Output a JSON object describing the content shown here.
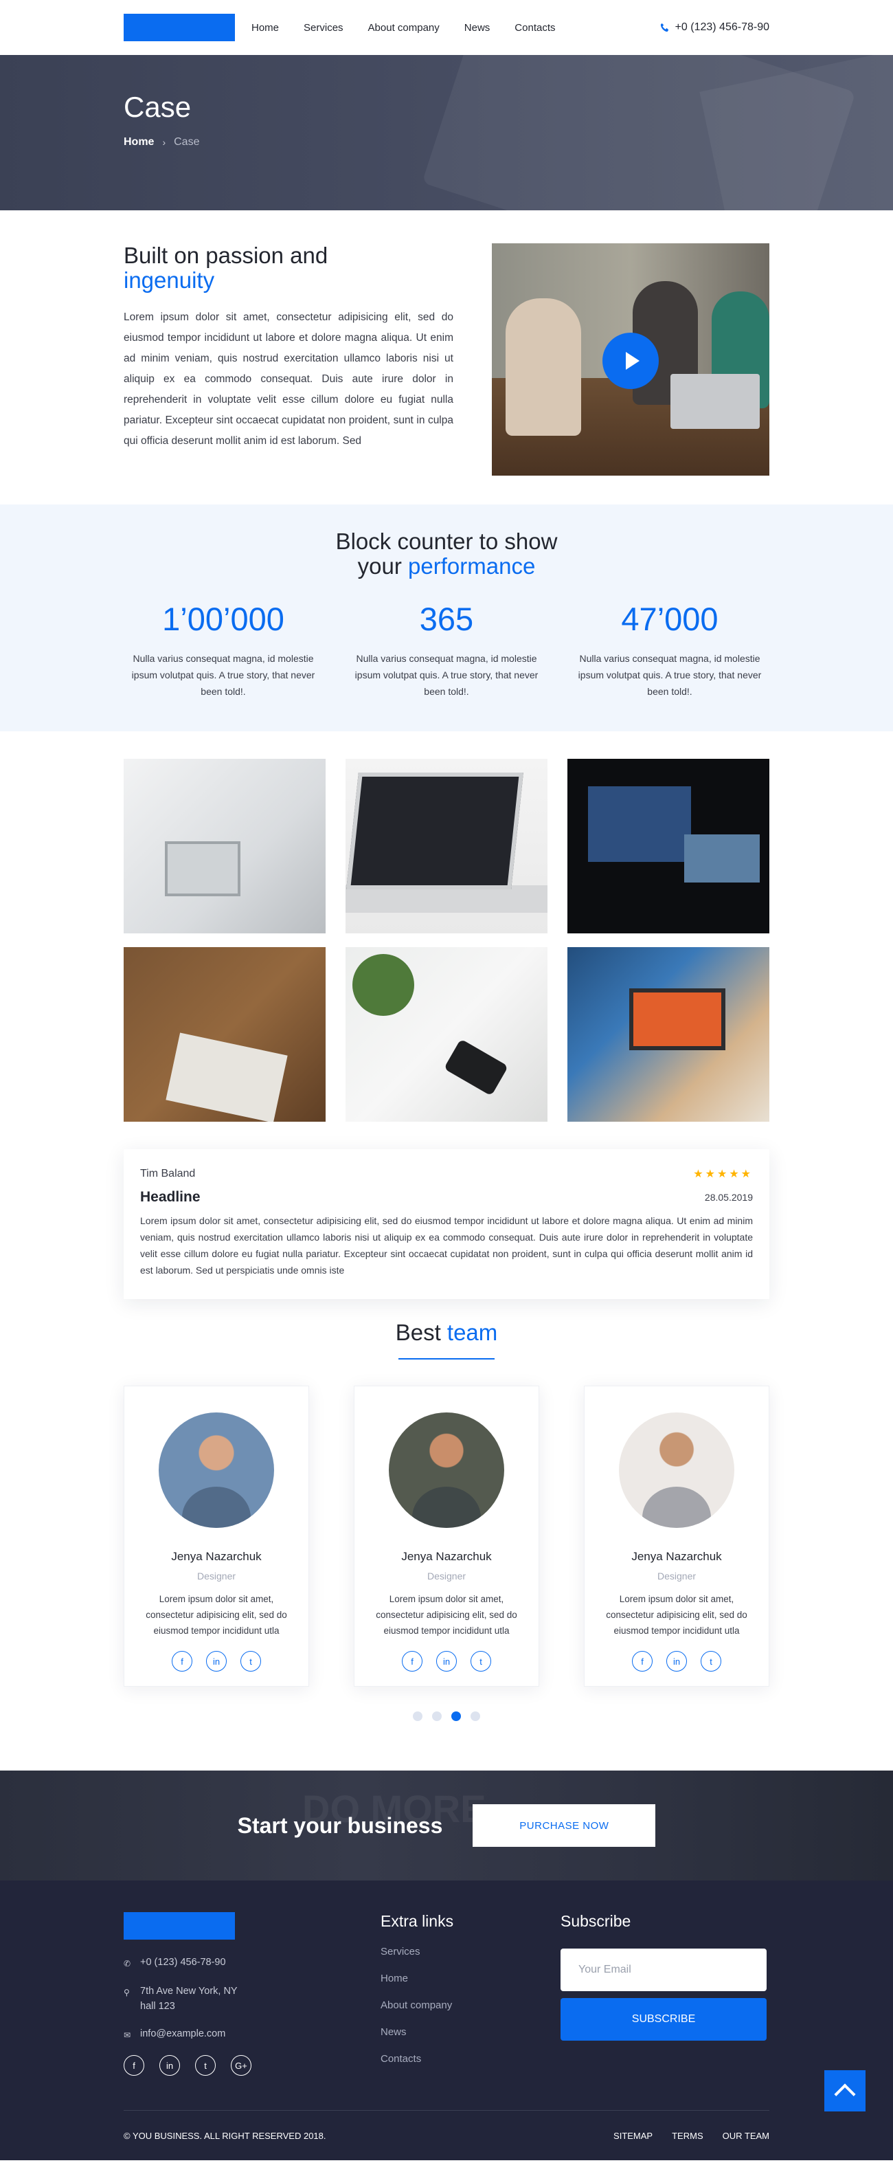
{
  "header": {
    "nav": [
      "Home",
      "Services",
      "About company",
      "News",
      "Contacts"
    ],
    "phone": "+0 (123) 456-78-90"
  },
  "hero": {
    "title": "Case",
    "breadcrumb": {
      "home": "Home",
      "separator": "›",
      "current": "Case"
    }
  },
  "intro": {
    "title_line1": "Built on passion and",
    "title_accent": "ingenuity",
    "text": "Lorem ipsum dolor sit amet, consectetur adipisicing elit, sed do eiusmod tempor incididunt ut labore et dolore magna aliqua. Ut enim ad minim veniam, quis nostrud exercitation ullamco laboris nisi ut aliquip ex ea commodo consequat. Duis aute irure dolor in reprehenderit in voluptate velit esse cillum dolore eu fugiat nulla pariatur. Excepteur sint occaecat cupidatat non proident, sunt in culpa qui officia deserunt mollit anim id est laborum. Sed"
  },
  "counters": {
    "title_line1": "Block counter to show",
    "title_line2_plain": "your ",
    "title_line2_accent": "performance",
    "items": [
      {
        "value": "1’00’000",
        "text": "Nulla varius consequat magna, id molestie ipsum volutpat quis. A true story, that never been told!."
      },
      {
        "value": "365",
        "text": "Nulla varius consequat magna, id molestie ipsum volutpat quis. A true story, that never been told!."
      },
      {
        "value": "47’000",
        "text": "Nulla varius consequat magna, id molestie ipsum volutpat quis. A true story, that never been told!."
      }
    ]
  },
  "review": {
    "author": "Tim Baland",
    "stars": "★★★★★",
    "headline": "Headline",
    "date": "28.05.2019",
    "text": "Lorem ipsum dolor sit amet, consectetur adipisicing elit, sed do eiusmod tempor incididunt ut labore et dolore magna aliqua. Ut enim ad minim veniam, quis nostrud exercitation ullamco laboris nisi ut aliquip ex ea commodo consequat. Duis aute irure dolor in reprehenderit in voluptate velit esse cillum dolore eu fugiat nulla pariatur. Excepteur sint occaecat cupidatat non proident, sunt in culpa qui officia deserunt mollit anim id est laborum. Sed ut perspiciatis unde omnis iste"
  },
  "team": {
    "title_plain": "Best ",
    "title_accent": "team",
    "members": [
      {
        "name": "Jenya Nazarchuk",
        "role": "Designer",
        "text": "Lorem ipsum dolor sit amet, consectetur adipisicing elit, sed do eiusmod tempor incididunt utla"
      },
      {
        "name": "Jenya Nazarchuk",
        "role": "Designer",
        "text": "Lorem ipsum dolor sit amet, consectetur adipisicing elit, sed do eiusmod tempor incididunt utla"
      },
      {
        "name": "Jenya Nazarchuk",
        "role": "Designer",
        "text": "Lorem ipsum dolor sit amet, consectetur adipisicing elit, sed do eiusmod tempor incididunt utla"
      }
    ],
    "social_icons": {
      "facebook": "f",
      "linkedin": "in",
      "twitter": "t",
      "google": "G+"
    },
    "slider": {
      "pages": 4,
      "active": 3
    }
  },
  "cta": {
    "title": "Start your business",
    "button": "PURCHASE NOW",
    "bg_word": "DO MORE."
  },
  "footer": {
    "phone": "+0 (123) 456-78-90",
    "address": "7th Ave New York, NY hall 123",
    "email": "info@example.com",
    "links_title": "Extra links",
    "links": [
      "Services",
      "Home",
      "About company",
      "News",
      "Contacts"
    ],
    "subscribe_title": "Subscribe",
    "email_placeholder": "Your Email",
    "subscribe_button": "SUBSCRIBE",
    "copyright": "© YOU BUSINESS. ALL RIGHT RESERVED 2018.",
    "bottom_links": [
      "SITEMAP",
      "TERMS",
      "OUR TEAM"
    ]
  },
  "colors": {
    "accent": "#0a6cf0",
    "dark": "#22253a",
    "star": "#ffb400",
    "counter_bg": "#f1f6fd"
  }
}
